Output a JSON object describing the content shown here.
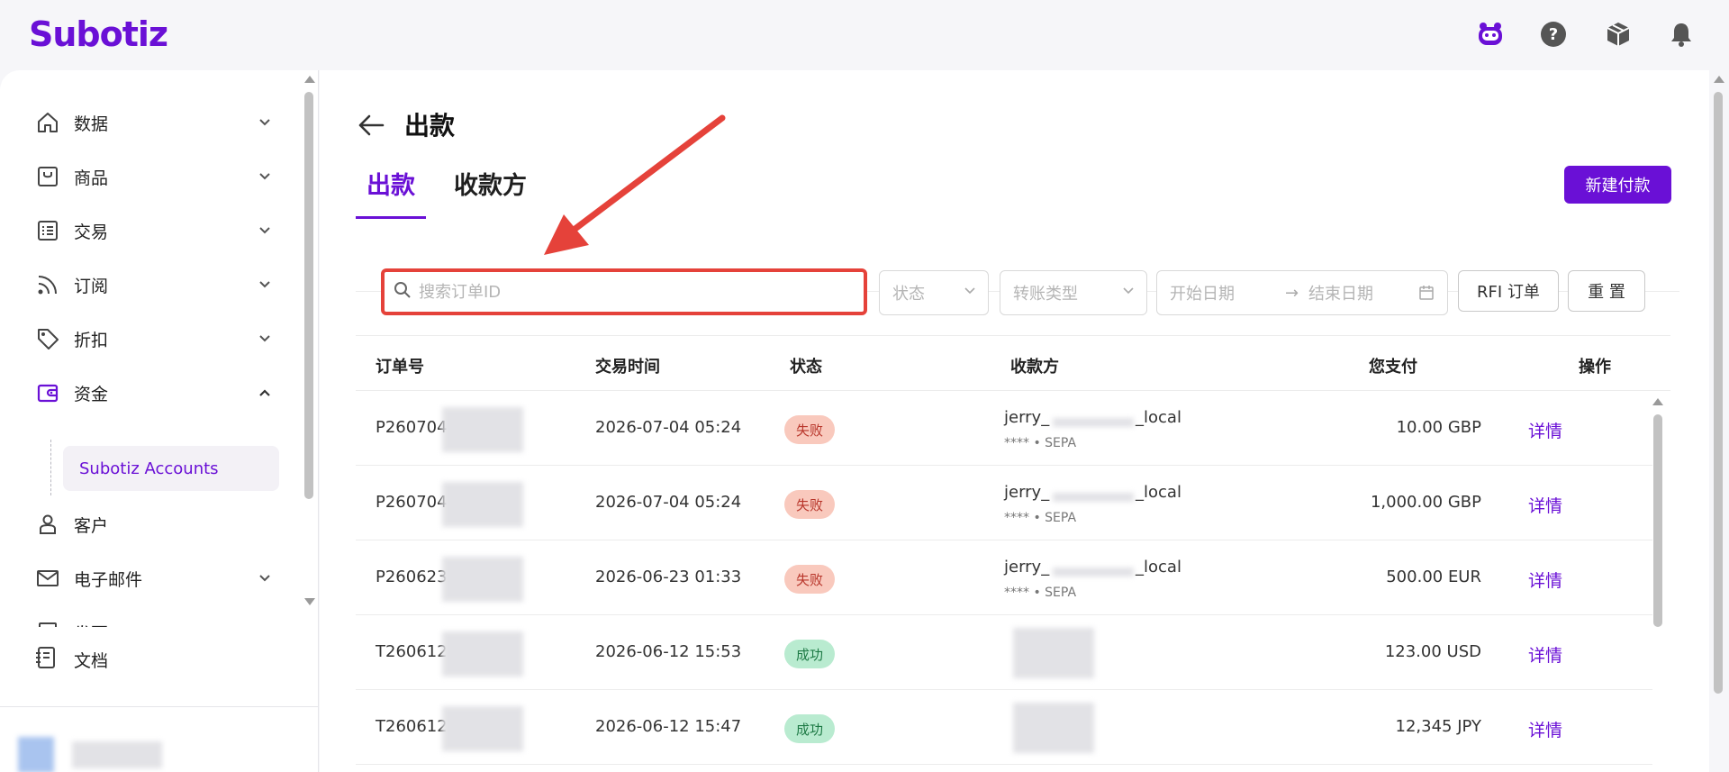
{
  "app": {
    "logo": "Subotiz"
  },
  "topbar": {
    "icons": [
      "assistant-icon",
      "help-icon",
      "package-icon",
      "bell-icon"
    ]
  },
  "sidebar": {
    "items": [
      {
        "label": "数据",
        "icon": "home-icon",
        "expanded": false
      },
      {
        "label": "商品",
        "icon": "shop-icon",
        "expanded": false
      },
      {
        "label": "交易",
        "icon": "list-icon",
        "expanded": false
      },
      {
        "label": "订阅",
        "icon": "rss-icon",
        "expanded": false
      },
      {
        "label": "折扣",
        "icon": "tag-icon",
        "expanded": false
      },
      {
        "label": "资金",
        "icon": "wallet-icon",
        "expanded": true
      },
      {
        "label": "客户",
        "icon": "user-icon",
        "expanded": false
      },
      {
        "label": "电子邮件",
        "icon": "mail-icon",
        "expanded": false
      },
      {
        "label": "发票",
        "icon": "invoice-icon",
        "expanded": false
      }
    ],
    "subitem": "Subotiz Accounts",
    "docs": "文档"
  },
  "main": {
    "title": "出款",
    "tabs": [
      {
        "label": "出款",
        "active": true
      },
      {
        "label": "收款方",
        "active": false
      }
    ],
    "new_button": "新建付款",
    "filters": {
      "search_placeholder": "搜索订单ID",
      "status_placeholder": "状态",
      "type_placeholder": "转账类型",
      "start_date": "开始日期",
      "end_date": "结束日期",
      "arrow": "→",
      "rfi_button": "RFI 订单",
      "reset_button": "重 置"
    },
    "table": {
      "columns": [
        "订单号",
        "交易时间",
        "状态",
        "收款方",
        "您支付",
        "操作"
      ],
      "rows": [
        {
          "order": "P260704",
          "time": "2026-07-04 05:24",
          "status": "失败",
          "status_type": "fail",
          "payee_pre": "jerry_",
          "payee_suf": "_local",
          "payee_sub": "**** • SEPA",
          "amount": "10.00 GBP",
          "action": "详情"
        },
        {
          "order": "P260704",
          "time": "2026-07-04 05:24",
          "status": "失败",
          "status_type": "fail",
          "payee_pre": "jerry_",
          "payee_suf": "_local",
          "payee_sub": "**** • SEPA",
          "amount": "1,000.00 GBP",
          "action": "详情"
        },
        {
          "order": "P260623",
          "time": "2026-06-23 01:33",
          "status": "失败",
          "status_type": "fail",
          "payee_pre": "jerry_",
          "payee_suf": "_local",
          "payee_sub": "**** • SEPA",
          "amount": "500.00 EUR",
          "action": "详情"
        },
        {
          "order": "T260612-",
          "time": "2026-06-12 15:53",
          "status": "成功",
          "status_type": "ok",
          "payee_pre": "",
          "payee_suf": "",
          "payee_sub": "",
          "amount": "123.00 USD",
          "action": "详情"
        },
        {
          "order": "T260612-",
          "time": "2026-06-12 15:47",
          "status": "成功",
          "status_type": "ok",
          "payee_pre": "",
          "payee_suf": "",
          "payee_sub": "",
          "amount": "12,345 JPY",
          "action": "详情"
        }
      ]
    }
  },
  "colors": {
    "brand": "#6a10d6",
    "annotation": "#e5423a",
    "fail_bg": "#f9c9bd",
    "ok_bg": "#b9ebd0"
  }
}
